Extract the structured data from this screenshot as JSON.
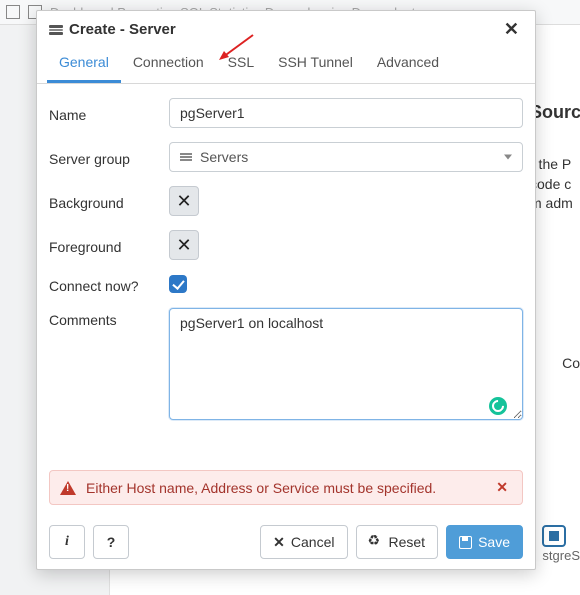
{
  "bg": {
    "nav": "Dashboard   Properties   SQL   Statistics   Dependencies   Dependent",
    "side_h": "Sourc",
    "side_1": "r the P",
    "side_2": "code c",
    "side_3": "m adm",
    "side_co": "Co",
    "side_pg": "stgreS"
  },
  "dialog": {
    "title": "Create - Server",
    "tabs": {
      "general": "General",
      "connection": "Connection",
      "ssl": "SSL",
      "ssh": "SSH Tunnel",
      "advanced": "Advanced"
    },
    "labels": {
      "name": "Name",
      "server_group": "Server group",
      "background": "Background",
      "foreground": "Foreground",
      "connect_now": "Connect now?",
      "comments": "Comments"
    },
    "values": {
      "name": "pgServer1",
      "server_group": "Servers",
      "comments": "pgServer1 on localhost",
      "connect_now": true
    },
    "alert": "Either Host name, Address or Service must be specified.",
    "buttons": {
      "info": "i",
      "help": "?",
      "cancel": "Cancel",
      "reset": "Reset",
      "save": "Save"
    }
  }
}
